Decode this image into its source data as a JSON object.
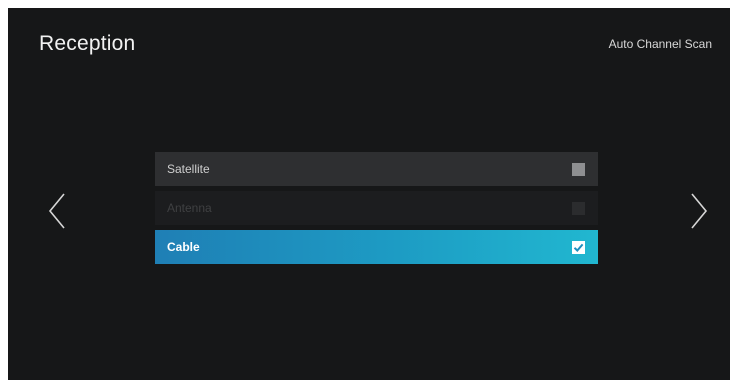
{
  "header": {
    "title": "Reception",
    "subtitle": "Auto Channel Scan"
  },
  "navigation": {
    "left_icon": "chevron-left-icon",
    "right_icon": "chevron-right-icon"
  },
  "options": [
    {
      "label": "Satellite",
      "checked": false,
      "state": "normal"
    },
    {
      "label": "Antenna",
      "checked": false,
      "state": "disabled"
    },
    {
      "label": "Cable",
      "checked": true,
      "state": "selected"
    }
  ],
  "colors": {
    "background": "#161718",
    "selected_start": "#1f7fb5",
    "selected_end": "#21b7d0"
  }
}
